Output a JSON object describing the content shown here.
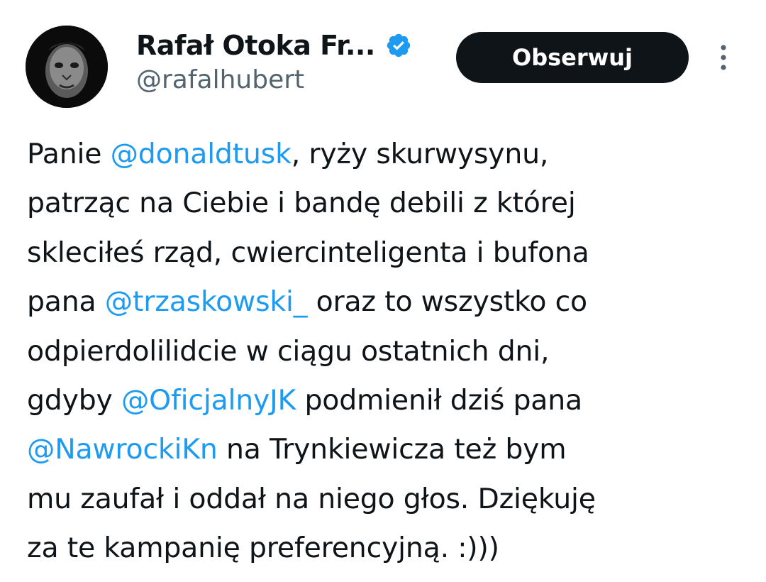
{
  "profile": {
    "display_name": "Rafał Otoka Fr...",
    "handle": "@rafalhubert",
    "verified": true,
    "verified_icon": "verified-badge-icon",
    "verified_color": "#1d9bf0"
  },
  "follow_button": {
    "label": "Obserwuj"
  },
  "more_button": {
    "icon": "more-vertical-icon"
  },
  "tweet": {
    "lines": [
      [
        "Panie ",
        "@donaldtusk",
        ", ryży skurwysynu,"
      ],
      [
        "patrząc na Ciebie i bandę debili z której"
      ],
      [
        "skleciłeś rząd, cwiercinteligenta i bufona"
      ],
      [
        "pana ",
        "@trzaskowski_",
        " oraz to wszystko co"
      ],
      [
        "odpierdolilidcie w ciągu ostatnich dni,"
      ],
      [
        "gdyby ",
        "@OficjalnyJK",
        " podmienił dziś pana"
      ],
      [
        "@NawrockiKn",
        " na Trynkiewicza też bym"
      ],
      [
        "mu zaufał i oddał na niego głos. Dziękuję"
      ],
      [
        "za te kampanię preferencyjną. :)))"
      ]
    ]
  },
  "colors": {
    "text": "#0f1419",
    "secondary_text": "#536471",
    "mention": "#1d9bf0",
    "button_bg": "#0f1419",
    "button_text": "#ffffff"
  }
}
